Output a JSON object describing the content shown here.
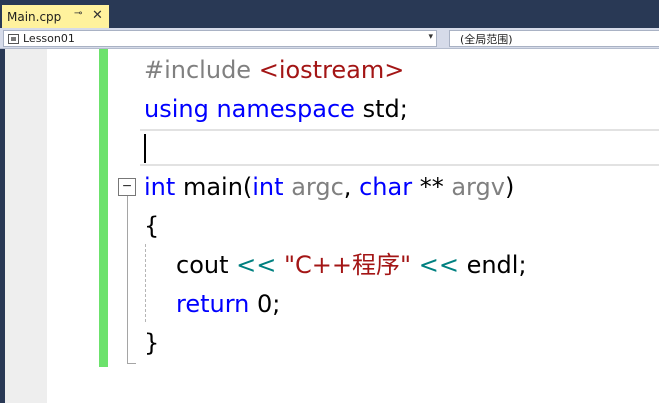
{
  "tab": {
    "title": "Main.cpp",
    "pin_glyph": "⊸",
    "close_glyph": "✕"
  },
  "nav": {
    "scope_left": "Lesson01",
    "scope_right": "(全局范围)",
    "dropdown_glyph": "▾"
  },
  "editor": {
    "outline_toggle": "−",
    "code": {
      "l1": {
        "directive": "#include",
        "header": "<iostream>"
      },
      "l2": {
        "kw_using": "using",
        "kw_namespace": "namespace",
        "rest": "std;"
      },
      "l3": {},
      "l4": {
        "kw_int": "int",
        "name": "main(",
        "kw_int2": "int",
        "p1": "argc",
        "comma": ",",
        "kw_char": "char",
        "stars": "**",
        "p2": "argv",
        "close": ")"
      },
      "l5": {
        "brace": "{"
      },
      "l6": {
        "cout": "cout",
        "op1": "<<",
        "str": "\"C++程序\"",
        "op2": "<<",
        "endl": "endl;"
      },
      "l7": {
        "kw_return": "return",
        "rest": "0;"
      },
      "l8": {
        "brace": "}"
      }
    }
  },
  "colors": {
    "frame": "#293955",
    "tab_active": "#fff29d",
    "change_bar": "#6ce26c",
    "keyword": "#0000ff",
    "string": "#a31515",
    "operator": "#008080",
    "parameter": "#808080"
  }
}
